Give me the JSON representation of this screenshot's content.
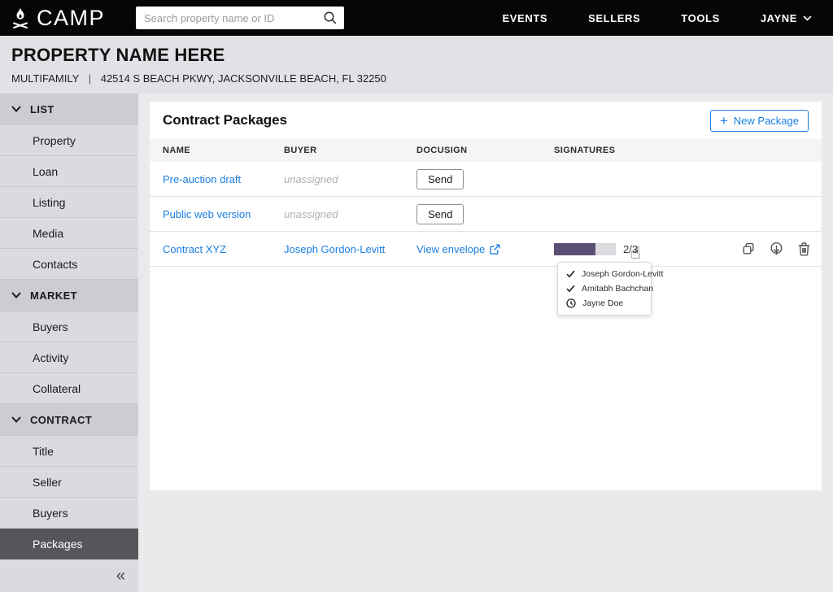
{
  "colors": {
    "topbar_bg": "#060606",
    "accent_blue": "#1b7fe0",
    "progress_purple": "#5b4e73",
    "progress_track": "#dcdade",
    "sidebar_bg": "#dcdae0",
    "sidebar_section_bg": "#cecbd3",
    "sidebar_selected_bg": "#57555a",
    "property_header_bg": "#e3e1e6",
    "page_bg": "#eaeaec"
  },
  "icons": {
    "logo": "campfire",
    "search": "magnifier",
    "chevron_down": "⌄",
    "plus": "+",
    "collapse": "«",
    "check": "✓",
    "clock": "clock-face",
    "external_link": "box-with-arrow",
    "copy": "overlapping-squares",
    "download": "circle-with-down-arrow",
    "trash": "trash-can",
    "pointer_cursor": "☝"
  },
  "topbar": {
    "logo_text": "CAMP",
    "search_placeholder": "Search property name or ID",
    "nav": [
      {
        "label": "EVENTS"
      },
      {
        "label": "SELLERS"
      },
      {
        "label": "TOOLS"
      }
    ],
    "user_label": "JAYNE"
  },
  "property_header": {
    "title": "PROPERTY NAME HERE",
    "type": "MULTIFAMILY",
    "separator": "|",
    "address": "42514 S BEACH PKWY, JACKSONVILLE BEACH, FL 32250"
  },
  "sidebar": {
    "sections": [
      {
        "label": "LIST",
        "items": [
          {
            "label": "Property"
          },
          {
            "label": "Loan"
          },
          {
            "label": "Listing"
          },
          {
            "label": "Media"
          },
          {
            "label": "Contacts"
          }
        ]
      },
      {
        "label": "MARKET",
        "items": [
          {
            "label": "Buyers"
          },
          {
            "label": "Activity"
          },
          {
            "label": "Collateral"
          }
        ]
      },
      {
        "label": "CONTRACT",
        "items": [
          {
            "label": "Title"
          },
          {
            "label": "Seller"
          },
          {
            "label": "Buyers"
          },
          {
            "label": "Packages"
          }
        ]
      }
    ],
    "selected_item": "Packages",
    "collapse_icon": "«"
  },
  "main": {
    "title": "Contract Packages",
    "new_package_button": "New Package",
    "plus": "+",
    "table": {
      "columns": [
        "NAME",
        "BUYER",
        "DOCUSIGN",
        "SIGNATURES"
      ],
      "rows": [
        {
          "name": "Pre-auction draft",
          "buyer": "unassigned",
          "docusign_action": "Send"
        },
        {
          "name": "Public web version",
          "buyer": "unassigned",
          "docusign_action": "Send"
        },
        {
          "name": "Contract XYZ",
          "buyer": "Joseph Gordon-Levitt",
          "docusign_action": "View envelope",
          "signatures": {
            "completed": 2,
            "total": 3,
            "label": "2/3"
          }
        }
      ]
    },
    "signers_popover": [
      {
        "name": "Joseph Gordon-Levitt",
        "status": "signed"
      },
      {
        "name": "Amitabh Bachchan",
        "status": "signed"
      },
      {
        "name": "Jayne Doe",
        "status": "pending"
      }
    ]
  }
}
